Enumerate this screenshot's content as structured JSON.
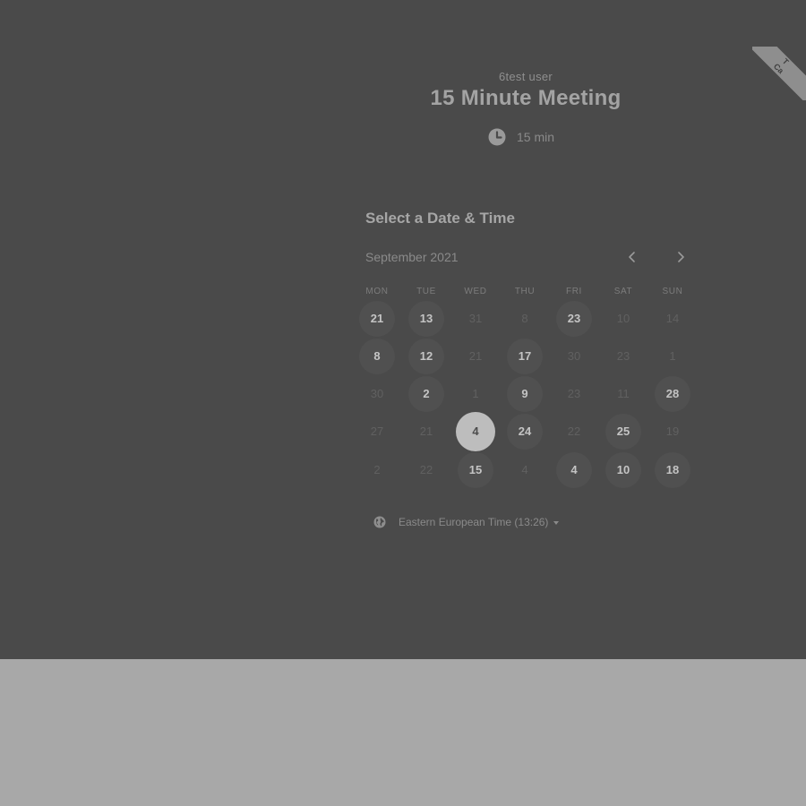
{
  "ribbon": {
    "line1": "T",
    "line2": "Ca"
  },
  "event": {
    "owner": "6test user",
    "title": "15 Minute Meeting",
    "duration": "15 min"
  },
  "booking": {
    "section_title": "Select a Date & Time",
    "month": "September 2021",
    "weekdays": [
      "MON",
      "TUE",
      "WED",
      "THU",
      "FRI",
      "SAT",
      "SUN"
    ],
    "weeks": [
      [
        {
          "d": "21",
          "s": "avail"
        },
        {
          "d": "13",
          "s": "avail"
        },
        {
          "d": "31",
          "s": "off"
        },
        {
          "d": "8",
          "s": "off"
        },
        {
          "d": "23",
          "s": "avail"
        },
        {
          "d": "10",
          "s": "off"
        },
        {
          "d": "14",
          "s": "off"
        }
      ],
      [
        {
          "d": "8",
          "s": "avail"
        },
        {
          "d": "12",
          "s": "avail"
        },
        {
          "d": "21",
          "s": "off"
        },
        {
          "d": "17",
          "s": "avail"
        },
        {
          "d": "30",
          "s": "off"
        },
        {
          "d": "23",
          "s": "off"
        },
        {
          "d": "1",
          "s": "off"
        }
      ],
      [
        {
          "d": "30",
          "s": "off"
        },
        {
          "d": "2",
          "s": "avail"
        },
        {
          "d": "1",
          "s": "off"
        },
        {
          "d": "9",
          "s": "avail"
        },
        {
          "d": "23",
          "s": "off"
        },
        {
          "d": "11",
          "s": "off"
        },
        {
          "d": "28",
          "s": "avail"
        }
      ],
      [
        {
          "d": "27",
          "s": "off"
        },
        {
          "d": "21",
          "s": "off"
        },
        {
          "d": "4",
          "s": "selected"
        },
        {
          "d": "24",
          "s": "avail"
        },
        {
          "d": "22",
          "s": "off"
        },
        {
          "d": "25",
          "s": "avail"
        },
        {
          "d": "19",
          "s": "off"
        }
      ],
      [
        {
          "d": "2",
          "s": "off"
        },
        {
          "d": "22",
          "s": "off"
        },
        {
          "d": "15",
          "s": "avail"
        },
        {
          "d": "4",
          "s": "off"
        },
        {
          "d": "4",
          "s": "avail"
        },
        {
          "d": "10",
          "s": "avail"
        },
        {
          "d": "18",
          "s": "avail"
        }
      ]
    ]
  },
  "timezone": {
    "label": "Eastern European Time (13:26)"
  },
  "icons": {
    "duration": "clock-icon",
    "timezone": "globe-icon",
    "prev": "chevron-left-icon",
    "next": "chevron-right-icon"
  },
  "colors": {
    "overlay": "#4a4a4a",
    "backdrop": "#a8a8a8",
    "selected_day": "#bdbdbd"
  }
}
